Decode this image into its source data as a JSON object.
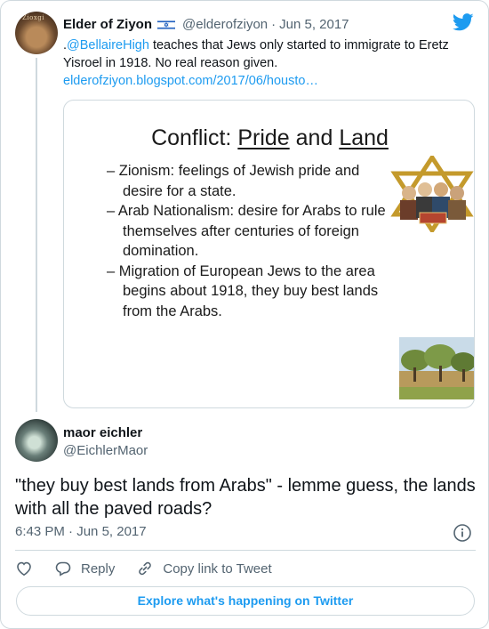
{
  "parent_tweet": {
    "avatar_text": "Zioxgi",
    "author_name": "Elder of Ziyon",
    "author_handle": "@elderofziyon",
    "separator": "·",
    "date": "Jun 5, 2017",
    "text_prefix": ".",
    "mention": "@BellaireHigh",
    "text_body": " teaches that Jews only started to immigrate to Eretz Yisroel in 1918. No real reason given.",
    "link": "elderofziyon.blogspot.com/2017/06/housto…",
    "slide": {
      "title_lead": "Conflict: ",
      "title_word1": "Pride",
      "title_and": " and ",
      "title_word2": "Land",
      "bullets": [
        "Zionism: feelings of Jewish pride and desire for a state.",
        "Arab Nationalism: desire for Arabs to rule themselves after centuries of foreign domination.",
        "Migration of European Jews to the area begins about 1918, they buy best lands from the Arabs."
      ]
    }
  },
  "reply_tweet": {
    "author_name": "maor eichler",
    "author_handle": "@EichlerMaor",
    "text": "\"they buy best lands from Arabs\" - lemme guess, the lands with all the paved roads?",
    "time": "6:43 PM",
    "separator": "·",
    "date": "Jun 5, 2017"
  },
  "actions": {
    "reply_label": "Reply",
    "copy_label": "Copy link to Tweet"
  },
  "explore_label": "Explore what's happening on Twitter",
  "colors": {
    "accent": "#1d9bf0",
    "text": "#0f1419",
    "secondary": "#536471",
    "border": "#cfd9de"
  },
  "icons": [
    "twitter-bird-icon",
    "israel-flag-icon",
    "info-icon",
    "heart-icon",
    "reply-icon",
    "link-icon"
  ]
}
